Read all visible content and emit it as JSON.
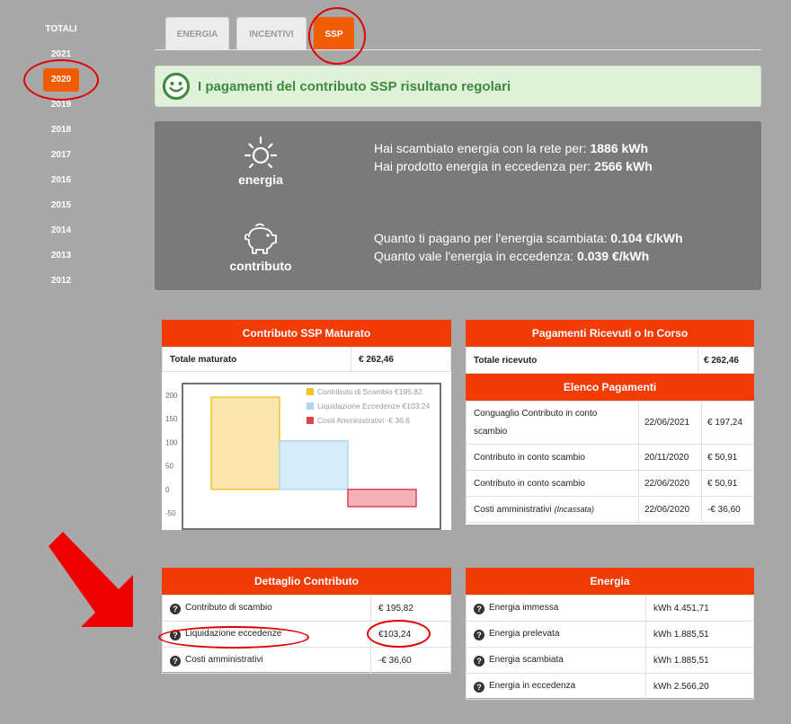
{
  "sidebar": {
    "totals_label": "TOTALI",
    "years": [
      "2021",
      "2020",
      "2019",
      "2018",
      "2017",
      "2016",
      "2015",
      "2014",
      "2013",
      "2012"
    ],
    "active_year": "2020"
  },
  "tabs": [
    {
      "label": "ENERGIA"
    },
    {
      "label": "INCENTIVI"
    },
    {
      "label": "SSP"
    }
  ],
  "alert": {
    "message": "I pagamenti del contributo SSP risultano regolari",
    "icon": "smile-icon"
  },
  "info": {
    "energia_label": "energia",
    "contributo_label": "contributo",
    "energia_line1_text": "Hai scambiato energia con la rete per: ",
    "energia_line1_value": "1886 kWh",
    "energia_line2_text": "Hai prodotto energia in eccedenza per: ",
    "energia_line2_value": "2566 kWh",
    "contributo_line1_text": "Quanto ti pagano per l'energia scambiata: ",
    "contributo_line1_value": "0.104 €/kWh",
    "contributo_line2_text": "Quanto vale l'energia in eccedenza: ",
    "contributo_line2_value": "0.039 €/kWh"
  },
  "maturato": {
    "title": "Contributo SSP Maturato",
    "total_label": "Totale maturato",
    "total_value": "€ 262,46"
  },
  "chart_data": {
    "type": "bar",
    "categories": [
      "Contributo di Scambio",
      "Liquidazione Eccedenze",
      "Costi Amministrativi"
    ],
    "values": [
      195.82,
      103.24,
      -36.6
    ],
    "legend": [
      "Contributo di Scambio €195.82",
      "Liquidazione Eccedenze €103.24",
      "Costi Amministrativi -€ 36.6"
    ],
    "colors": [
      "#f5c325",
      "#a9d6f0",
      "#e0434e"
    ],
    "fills": [
      "#fbe6b0",
      "#d8ecf8",
      "#f4b1b7"
    ],
    "ylim": [
      -50,
      200
    ],
    "yticks": [
      "200",
      "150",
      "100",
      "50",
      "0",
      "-50"
    ],
    "ytick_values": [
      200,
      150,
      100,
      50,
      0,
      -50
    ],
    "legend_position": "top-right",
    "grid": false
  },
  "pagamenti": {
    "title": "Pagamenti Ricevuti o In Corso",
    "total_label": "Totale ricevuto",
    "total_value": "€ 262,46",
    "elenco_title": "Elenco Pagamenti",
    "rows": [
      {
        "desc": "Conguaglio Contributo in conto scambio",
        "note": "",
        "date": "22/06/2021",
        "amount": "€ 197,24"
      },
      {
        "desc": "Contributo in conto scambio",
        "note": "",
        "date": "20/11/2020",
        "amount": "€ 50,91"
      },
      {
        "desc": "Contributo in conto scambio",
        "note": "",
        "date": "22/06/2020",
        "amount": "€ 50,91"
      },
      {
        "desc": "Costi amministrativi ",
        "note": "(Incassata)",
        "date": "22/06/2020",
        "amount": "-€ 36,60"
      }
    ]
  },
  "dettaglio": {
    "title": "Dettaglio Contributo",
    "rows": [
      {
        "label": "Contributo di scambio",
        "value": "€ 195,82"
      },
      {
        "label": "Liquidazione eccedenze",
        "value": "€103,24"
      },
      {
        "label": "Costi amministrativi",
        "value": "-€ 36,60"
      }
    ]
  },
  "energia": {
    "title": "Energia",
    "rows": [
      {
        "label": "Energia immessa",
        "value": "kWh 4.451,71"
      },
      {
        "label": "Energia prelevata",
        "value": "kWh 1.885,51"
      },
      {
        "label": "Energia scambiata",
        "value": "kWh 1.885,51"
      },
      {
        "label": "Energia in eccedenza",
        "value": "kWh 2.566,20"
      }
    ]
  },
  "colors": {
    "accent": "#f25c05",
    "card_header": "#f23b05",
    "success": "#3d8b3d",
    "annotation": "#e00000"
  }
}
